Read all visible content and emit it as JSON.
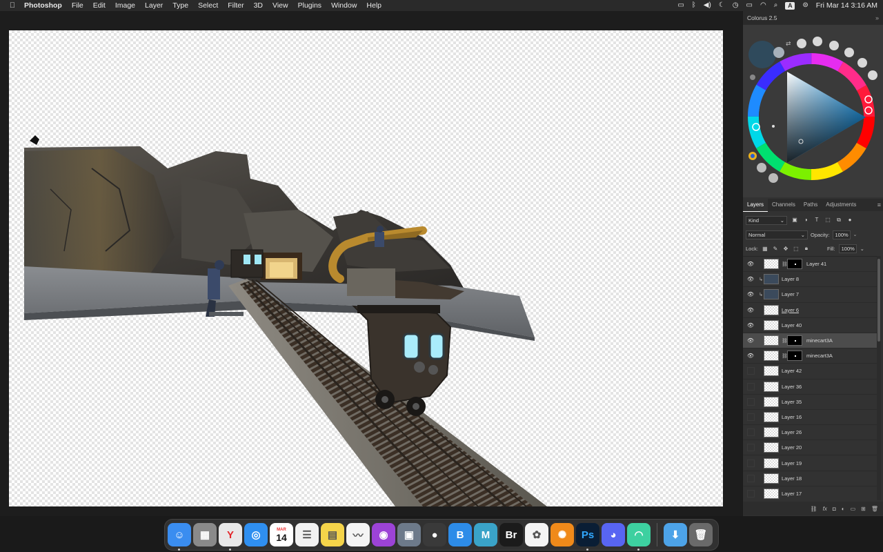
{
  "menubar": {
    "apple_icon": "apple-logo-icon",
    "app_name": "Photoshop",
    "menus": [
      "File",
      "Edit",
      "Image",
      "Layer",
      "Type",
      "Select",
      "Filter",
      "3D",
      "View",
      "Plugins",
      "Window",
      "Help"
    ],
    "status_icons": [
      "display-icon",
      "bluetooth-icon",
      "volume-icon",
      "moon-icon",
      "clock-icon",
      "battery-icon",
      "wifi-icon",
      "search-icon"
    ],
    "keyboard_input": "A",
    "control_center_icon": "control-center-icon",
    "datetime": "Fri Mar 14  3:16 AM"
  },
  "colorus": {
    "title": "Colorus 2.5",
    "current_color": "#2f4a5c"
  },
  "layers_panel": {
    "tabs": [
      "Layers",
      "Channels",
      "Paths",
      "Adjustments"
    ],
    "active_tab": "Layers",
    "filter_kind": "Kind",
    "blend_mode": "Normal",
    "opacity_label": "Opacity:",
    "opacity_value": "100%",
    "lock_label": "Lock:",
    "fill_label": "Fill:",
    "fill_value": "100%",
    "layers": [
      {
        "name": "Layer 41",
        "visible": true,
        "mask": true,
        "clip": false
      },
      {
        "name": "Layer 8",
        "visible": true,
        "mask": false,
        "clip": true
      },
      {
        "name": "Layer 7",
        "visible": true,
        "mask": false,
        "clip": true
      },
      {
        "name": "Layer 6",
        "visible": true,
        "mask": false,
        "clip": false,
        "underline": true
      },
      {
        "name": "Layer 40",
        "visible": true,
        "mask": false,
        "clip": false
      },
      {
        "name": "minecart3A",
        "visible": true,
        "mask": true,
        "clip": false,
        "selected": true
      },
      {
        "name": "minecart3A",
        "visible": true,
        "mask": true,
        "clip": false
      },
      {
        "name": "Layer 42",
        "visible": false,
        "mask": false,
        "clip": false
      },
      {
        "name": "Layer 36",
        "visible": false,
        "mask": false,
        "clip": false
      },
      {
        "name": "Layer 35",
        "visible": false,
        "mask": false,
        "clip": false
      },
      {
        "name": "Layer 16",
        "visible": false,
        "mask": false,
        "clip": false
      },
      {
        "name": "Layer 26",
        "visible": false,
        "mask": false,
        "clip": false
      },
      {
        "name": "Layer 20",
        "visible": false,
        "mask": false,
        "clip": false
      },
      {
        "name": "Layer 19",
        "visible": false,
        "mask": false,
        "clip": false
      },
      {
        "name": "Layer 18",
        "visible": false,
        "mask": false,
        "clip": false
      },
      {
        "name": "Layer 17",
        "visible": false,
        "mask": false,
        "clip": false
      }
    ]
  },
  "dock": {
    "apps": [
      {
        "name": "finder",
        "glyph": "☺",
        "color": "#3a8df0",
        "running": true
      },
      {
        "name": "launchpad",
        "glyph": "▦",
        "color": "#8a8a8a",
        "running": false
      },
      {
        "name": "yandex-browser",
        "glyph": "Y",
        "color": "#e8e8e8",
        "running": true
      },
      {
        "name": "safari",
        "glyph": "◎",
        "color": "#2f8ff0",
        "running": false
      },
      {
        "name": "calendar",
        "glyph": "",
        "color": "#ffffff",
        "running": false
      },
      {
        "name": "reminders",
        "glyph": "☰",
        "color": "#f2f2f2",
        "running": false
      },
      {
        "name": "notes",
        "glyph": "▤",
        "color": "#f5d44a",
        "running": false
      },
      {
        "name": "freeform",
        "glyph": "〰",
        "color": "#f4f4f4",
        "running": false
      },
      {
        "name": "podcasts",
        "glyph": "◉",
        "color": "#9c43d6",
        "running": false
      },
      {
        "name": "preview",
        "glyph": "▣",
        "color": "#6d7a8a",
        "running": false
      },
      {
        "name": "camera-app",
        "glyph": "●",
        "color": "#3a3a3a",
        "running": false
      },
      {
        "name": "bazaar-app",
        "glyph": "B",
        "color": "#2d8ce8",
        "running": false
      },
      {
        "name": "m-app",
        "glyph": "M",
        "color": "#3aa3c8",
        "running": false
      },
      {
        "name": "adobe-bridge",
        "glyph": "Br",
        "color": "#1b1b1b",
        "running": false
      },
      {
        "name": "photos",
        "glyph": "✿",
        "color": "#f4f4f4",
        "running": false
      },
      {
        "name": "xnview",
        "glyph": "✺",
        "color": "#f08a1a",
        "running": false
      },
      {
        "name": "photoshop",
        "glyph": "Ps",
        "color": "#0a1e35",
        "running": true
      },
      {
        "name": "discord",
        "glyph": "◕",
        "color": "#5865f2",
        "running": false
      },
      {
        "name": "cleanmymac",
        "glyph": "◠",
        "color": "#3dd0a0",
        "running": true
      }
    ],
    "calendar_month": "MAR",
    "calendar_day": "14",
    "folder_icon": "downloads-folder-icon",
    "trash_icon": "trash-icon"
  }
}
